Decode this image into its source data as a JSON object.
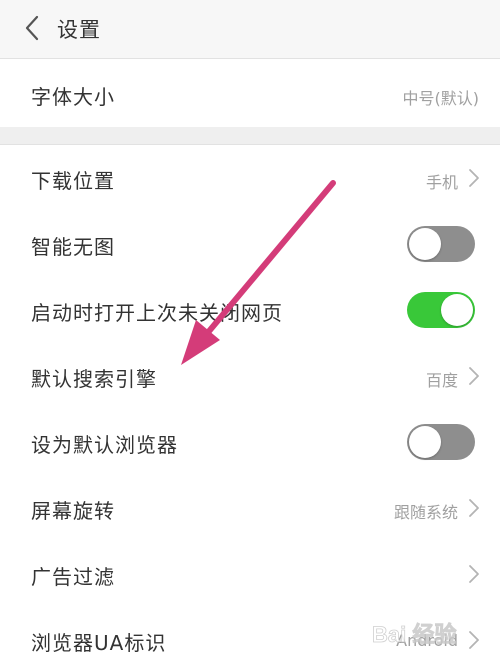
{
  "header": {
    "title": "设置"
  },
  "rows": [
    {
      "label": "字体大小",
      "value": "中号(默认)"
    },
    {
      "label": "下载位置",
      "value": "手机"
    },
    {
      "label": "智能无图",
      "toggle": "off"
    },
    {
      "label": "启动时打开上次未关闭网页",
      "toggle": "on"
    },
    {
      "label": "默认搜索引擎",
      "value": "百度"
    },
    {
      "label": "设为默认浏览器",
      "toggle": "off"
    },
    {
      "label": "屏幕旋转",
      "value": "跟随系统"
    },
    {
      "label": "广告过滤",
      "value": ""
    },
    {
      "label": "浏览器UA标识",
      "value": "Android"
    }
  ],
  "colors": {
    "toggle_on": "#39c839",
    "toggle_off": "#8e8e8e",
    "arrow": "#d43c79"
  },
  "watermark": {
    "text": "Bai 经验"
  }
}
